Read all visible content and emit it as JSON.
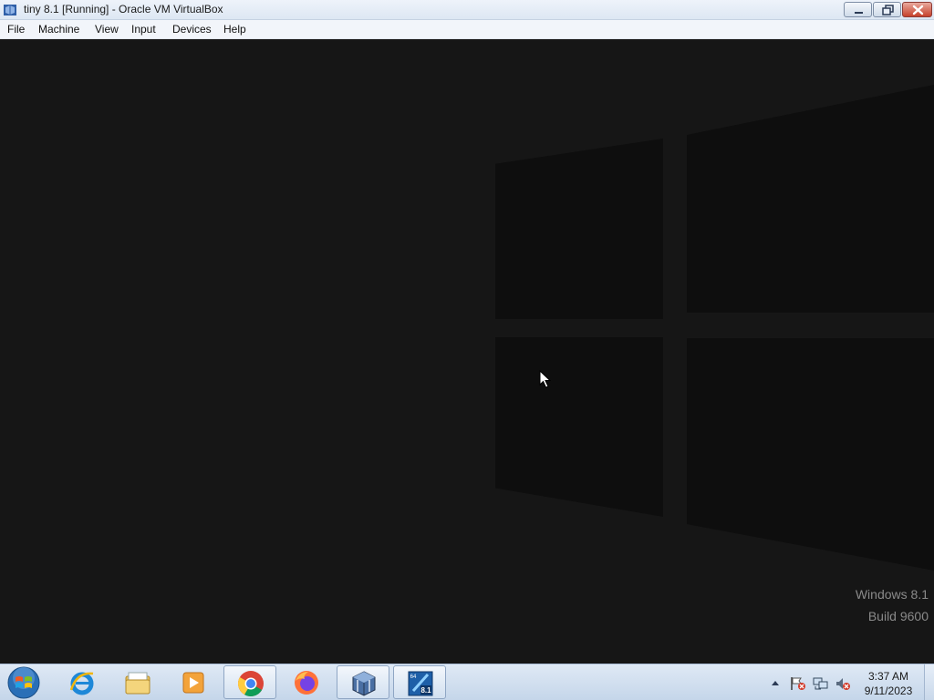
{
  "window": {
    "title": "tiny 8.1 [Running] - Oracle VM VirtualBox",
    "app_icon": "virtualbox-icon",
    "controls": [
      "minimize-icon",
      "maximize-icon",
      "close-icon"
    ]
  },
  "menu": {
    "items": [
      {
        "label": "File"
      },
      {
        "label": "Machine"
      },
      {
        "label": "View"
      },
      {
        "label": "Input"
      },
      {
        "label": "Devices"
      },
      {
        "label": "Help"
      }
    ]
  },
  "guest": {
    "watermark_line1": "Windows 8.1",
    "watermark_line2": "Build 9600",
    "background_color": "#161616"
  },
  "taskbar": {
    "start_icon": "windows-start-orb-icon",
    "pinned": [
      {
        "icon": "internet-explorer-icon",
        "active": false
      },
      {
        "icon": "file-explorer-icon",
        "active": false
      },
      {
        "icon": "media-player-icon",
        "active": false
      },
      {
        "icon": "chrome-icon",
        "active": true
      },
      {
        "icon": "firefox-icon",
        "active": false
      },
      {
        "icon": "virtualbox-icon",
        "active": true
      },
      {
        "icon": "windows-8-1-vm-icon",
        "active": true
      }
    ],
    "tray_icons": [
      "show-hidden-icons-arrow",
      "action-center-flag-icon",
      "network-icon",
      "volume-muted-icon"
    ],
    "clock": {
      "time": "3:37 AM",
      "date": "9/11/2023"
    }
  }
}
